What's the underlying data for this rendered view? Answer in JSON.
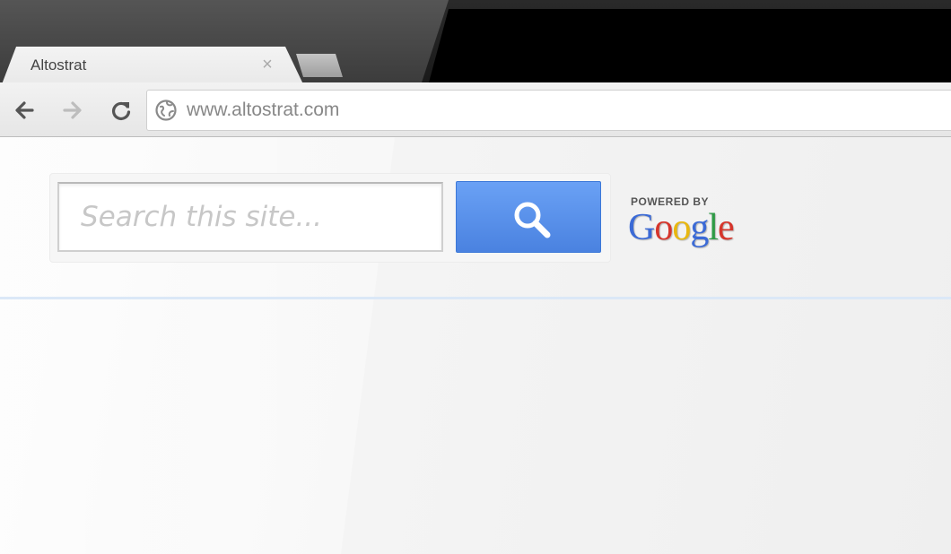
{
  "tab": {
    "title": "Altostrat",
    "close_glyph": "×"
  },
  "toolbar": {
    "back_icon": "back-arrow-icon",
    "forward_icon": "forward-arrow-icon",
    "reload_icon": "reload-icon",
    "address": {
      "icon": "globe-icon",
      "url": "www.altostrat.com"
    }
  },
  "search": {
    "placeholder": "Search this site...",
    "button_icon": "magnifier-icon",
    "button_color": "#4a86e8"
  },
  "branding": {
    "powered_by": "POWERED BY",
    "google": [
      "G",
      "o",
      "o",
      "g",
      "l",
      "e"
    ],
    "google_colors": [
      "#3b6ad6",
      "#d6352b",
      "#e8b70f",
      "#3b6ad6",
      "#2f9b46",
      "#d6352b"
    ]
  }
}
